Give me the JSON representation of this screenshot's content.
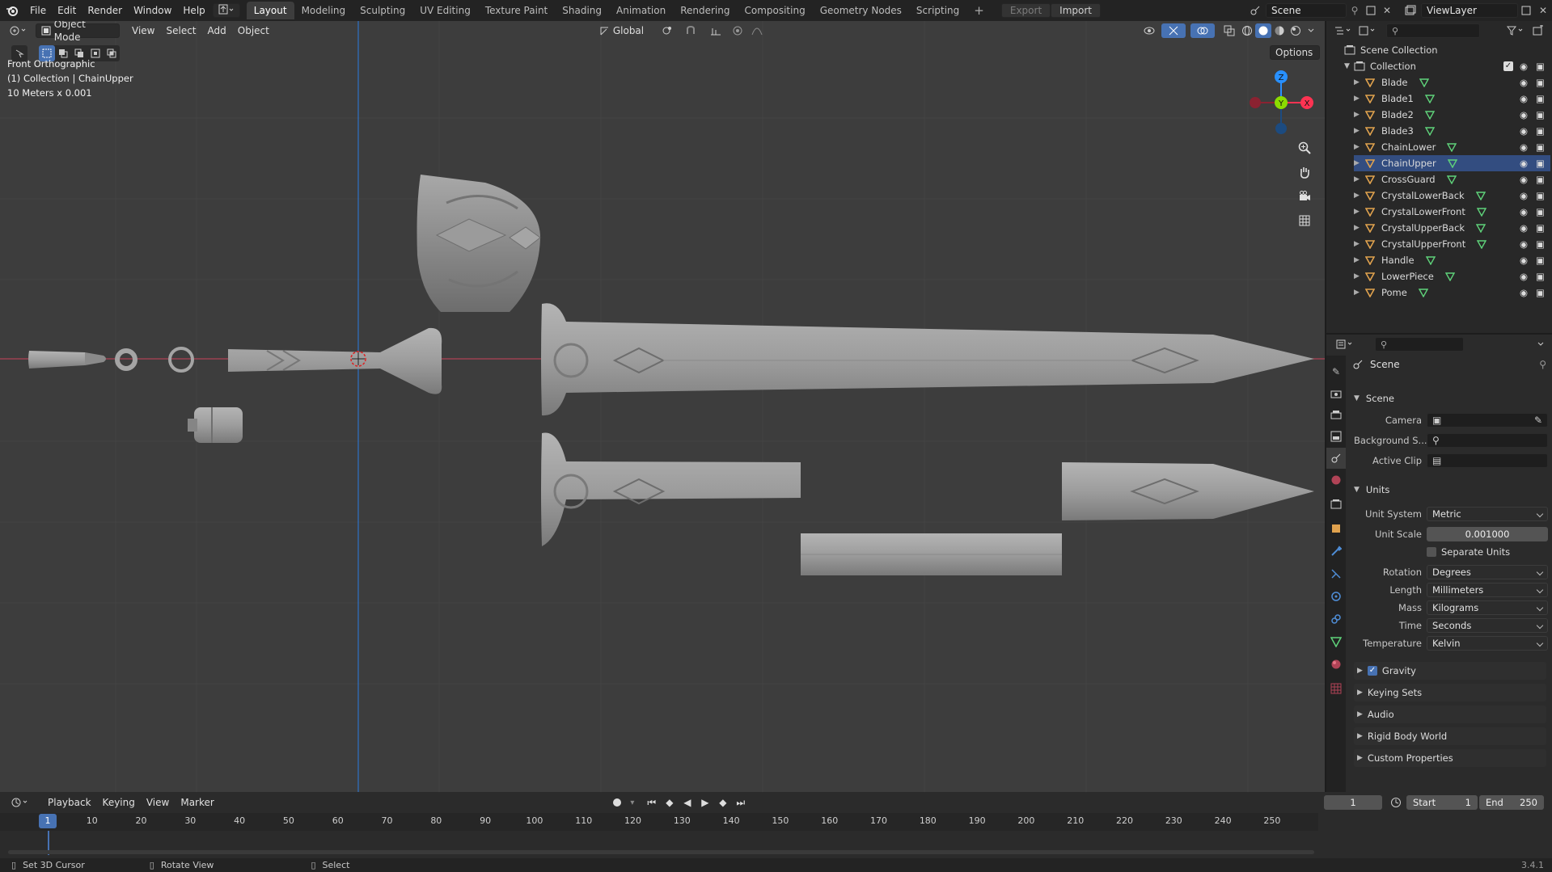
{
  "menu": [
    "File",
    "Edit",
    "Render",
    "Window",
    "Help"
  ],
  "tabs": [
    {
      "label": "Layout",
      "active": true
    },
    {
      "label": "Modeling"
    },
    {
      "label": "Sculpting"
    },
    {
      "label": "UV Editing"
    },
    {
      "label": "Texture Paint"
    },
    {
      "label": "Shading"
    },
    {
      "label": "Animation"
    },
    {
      "label": "Rendering"
    },
    {
      "label": "Compositing"
    },
    {
      "label": "Geometry Nodes"
    },
    {
      "label": "Scripting"
    }
  ],
  "topbar": {
    "export_label": "Export",
    "import_label": "Import",
    "scene_name": "Scene",
    "view_layer": "ViewLayer"
  },
  "viewport": {
    "mode": "Object Mode",
    "menus": [
      "View",
      "Select",
      "Add",
      "Object"
    ],
    "transform": "Global",
    "options_label": "Options",
    "info": {
      "view": "Front Orthographic",
      "collection": "(1) Collection | ChainUpper",
      "scale": "10 Meters x 0.001"
    },
    "gizmo": {
      "z": "Z",
      "y": "Y",
      "x": "X"
    }
  },
  "outliner": {
    "root": "Scene Collection",
    "collection": "Collection",
    "items": [
      "Blade",
      "Blade1",
      "Blade2",
      "Blade3",
      "ChainLower",
      "ChainUpper",
      "CrossGuard",
      "CrystalLowerBack",
      "CrystalLowerFront",
      "CrystalUpperBack",
      "CrystalUpperFront",
      "Handle",
      "LowerPiece",
      "Pome"
    ],
    "selected": "ChainUpper"
  },
  "properties": {
    "context": "Scene",
    "scene_panel": {
      "title": "Scene",
      "camera_label": "Camera",
      "background_label": "Background S...",
      "clip_label": "Active Clip"
    },
    "units_panel": {
      "title": "Units",
      "unit_system_label": "Unit System",
      "unit_system": "Metric",
      "unit_scale_label": "Unit Scale",
      "unit_scale": "0.001000",
      "separate_units": "Separate Units",
      "rotation_label": "Rotation",
      "rotation": "Degrees",
      "length_label": "Length",
      "length": "Millimeters",
      "mass_label": "Mass",
      "mass": "Kilograms",
      "time_label": "Time",
      "time": "Seconds",
      "temperature_label": "Temperature",
      "temperature": "Kelvin"
    },
    "collapsed": [
      "Gravity",
      "Keying Sets",
      "Audio",
      "Rigid Body World",
      "Custom Properties"
    ]
  },
  "timeline": {
    "menus": [
      "Playback",
      "Keying",
      "View",
      "Marker"
    ],
    "current_frame": "1",
    "start_label": "Start",
    "start": "1",
    "end_label": "End",
    "end": "250",
    "ruler": [
      "10",
      "20",
      "30",
      "40",
      "50",
      "60",
      "70",
      "80",
      "90",
      "100",
      "110",
      "120",
      "130",
      "140",
      "150",
      "160",
      "170",
      "180",
      "190",
      "200",
      "210",
      "220",
      "230",
      "240",
      "250"
    ],
    "playhead": "1"
  },
  "status": {
    "set_cursor": "Set 3D Cursor",
    "rotate": "Rotate View",
    "select": "Select",
    "version": "3.4.1"
  },
  "colors": {
    "accent": "#4772b3",
    "axis_x": "#ff3352",
    "axis_y": "#8bdc00",
    "axis_z": "#2890ff",
    "object_orange": "#e0a24e",
    "mesh_green": "#5fd37a",
    "mesh": "#9a9a9a"
  }
}
